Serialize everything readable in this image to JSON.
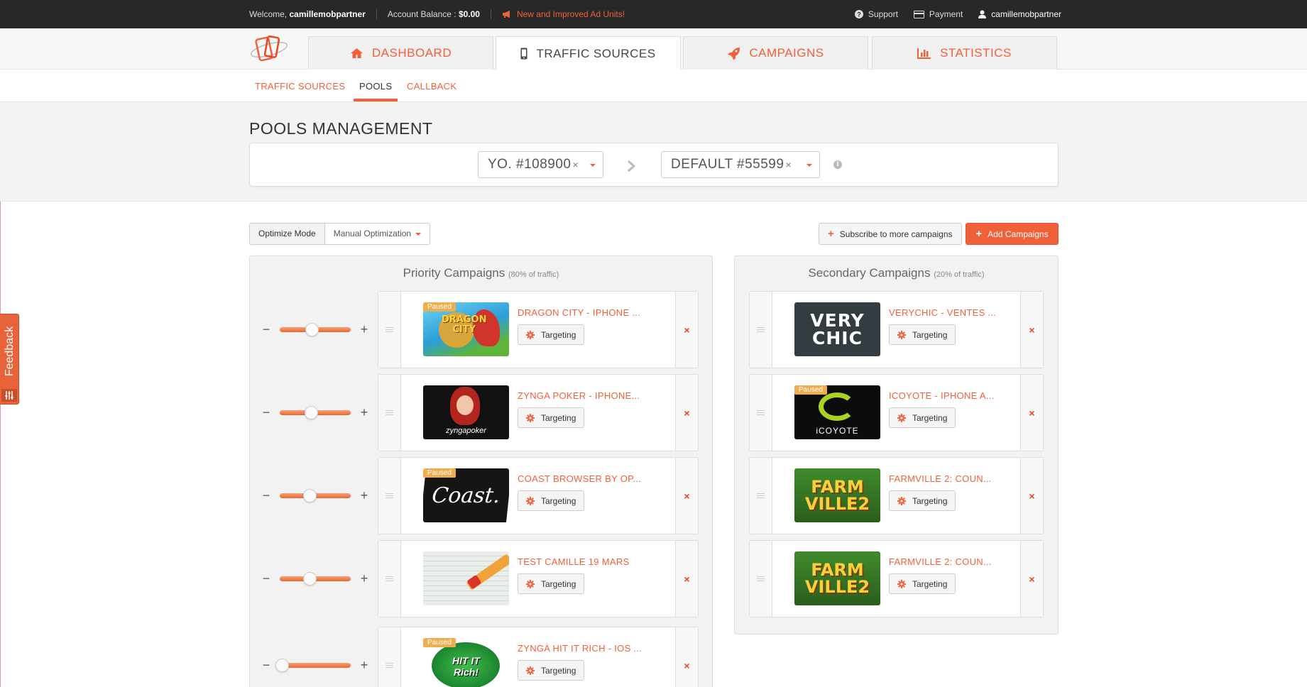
{
  "topbar": {
    "welcome_prefix": "Welcome,",
    "username": "camillemobpartner",
    "balance_label": "Account Balance :",
    "balance_value": "$0.00",
    "promo": "New and Improved Ad Units!",
    "support": "Support",
    "payment": "Payment",
    "user_menu": "camillemobpartner"
  },
  "nav": {
    "tabs": [
      {
        "label": "DASHBOARD",
        "icon": "home-icon"
      },
      {
        "label": "TRAFFIC SOURCES",
        "icon": "mobile-icon"
      },
      {
        "label": "CAMPAIGNS",
        "icon": "rocket-icon"
      },
      {
        "label": "STATISTICS",
        "icon": "bar-chart-icon"
      }
    ],
    "active_tab": "TRAFFIC SOURCES"
  },
  "subnav": {
    "items": [
      "TRAFFIC SOURCES",
      "POOLS",
      "CALLBACK"
    ],
    "active": "POOLS"
  },
  "page": {
    "title": "POOLS MANAGEMENT",
    "source_select": "YO. #108900",
    "pool_select": "DEFAULT #55599",
    "clear_symbol": "×"
  },
  "toolbar": {
    "optimize_label": "Optimize Mode",
    "optimize_value": "Manual Optimization",
    "subscribe_label": "Subscribe to more campaigns",
    "add_label": "Add Campaigns"
  },
  "priority": {
    "title": "Priority Campaigns",
    "share": "(80% of traffic)",
    "rows": [
      {
        "title": "DRAGON CITY - IPHONE ...",
        "paused": true,
        "weight": 0.45,
        "thumb": "dragon-city"
      },
      {
        "title": "ZYNGA POKER - IPHONE...",
        "paused": false,
        "weight": 0.44,
        "thumb": "zynga-poker"
      },
      {
        "title": "COAST BROWSER BY OP...",
        "paused": true,
        "weight": 0.42,
        "thumb": "coast"
      },
      {
        "title": "TEST CAMILLE 19 MARS",
        "paused": false,
        "weight": 0.42,
        "thumb": "test"
      },
      {
        "title": "ZYNGA HIT IT RICH - IOS ...",
        "paused": true,
        "weight": 0.03,
        "thumb": "hit-it-rich"
      }
    ]
  },
  "secondary": {
    "title": "Secondary Campaigns",
    "share": "(20% of traffic)",
    "rows": [
      {
        "title": "VERYCHIC - VENTES ...",
        "paused": false,
        "thumb": "verychic"
      },
      {
        "title": "ICOYOTE - IPHONE A...",
        "paused": true,
        "thumb": "icoyote"
      },
      {
        "title": "FARMVILLE 2: COUN...",
        "paused": false,
        "thumb": "farmville"
      },
      {
        "title": "FARMVILLE 2: COUN...",
        "paused": false,
        "thumb": "farmville"
      }
    ]
  },
  "labels": {
    "targeting": "Targeting",
    "paused": "Paused",
    "feedback": "Feedback",
    "minus": "−",
    "plus": "+",
    "delete": "×"
  },
  "thumb_text": {
    "verychic_1": "VERY",
    "verychic_2": "CHIC",
    "icoyote": "iCOYOTE",
    "farmville_1": "FARM",
    "farmville_2": "VILLE2",
    "zynga": "zyngapoker",
    "coast": "Coast.",
    "dragon_1": "DRAGON",
    "dragon_2": "CITY",
    "hitrich_1": "HIT IT",
    "hitrich_2": "Rich!"
  },
  "colors": {
    "accent": "#f0613a",
    "paused_badge": "#f0ad4e",
    "topbar_bg": "#282828"
  }
}
